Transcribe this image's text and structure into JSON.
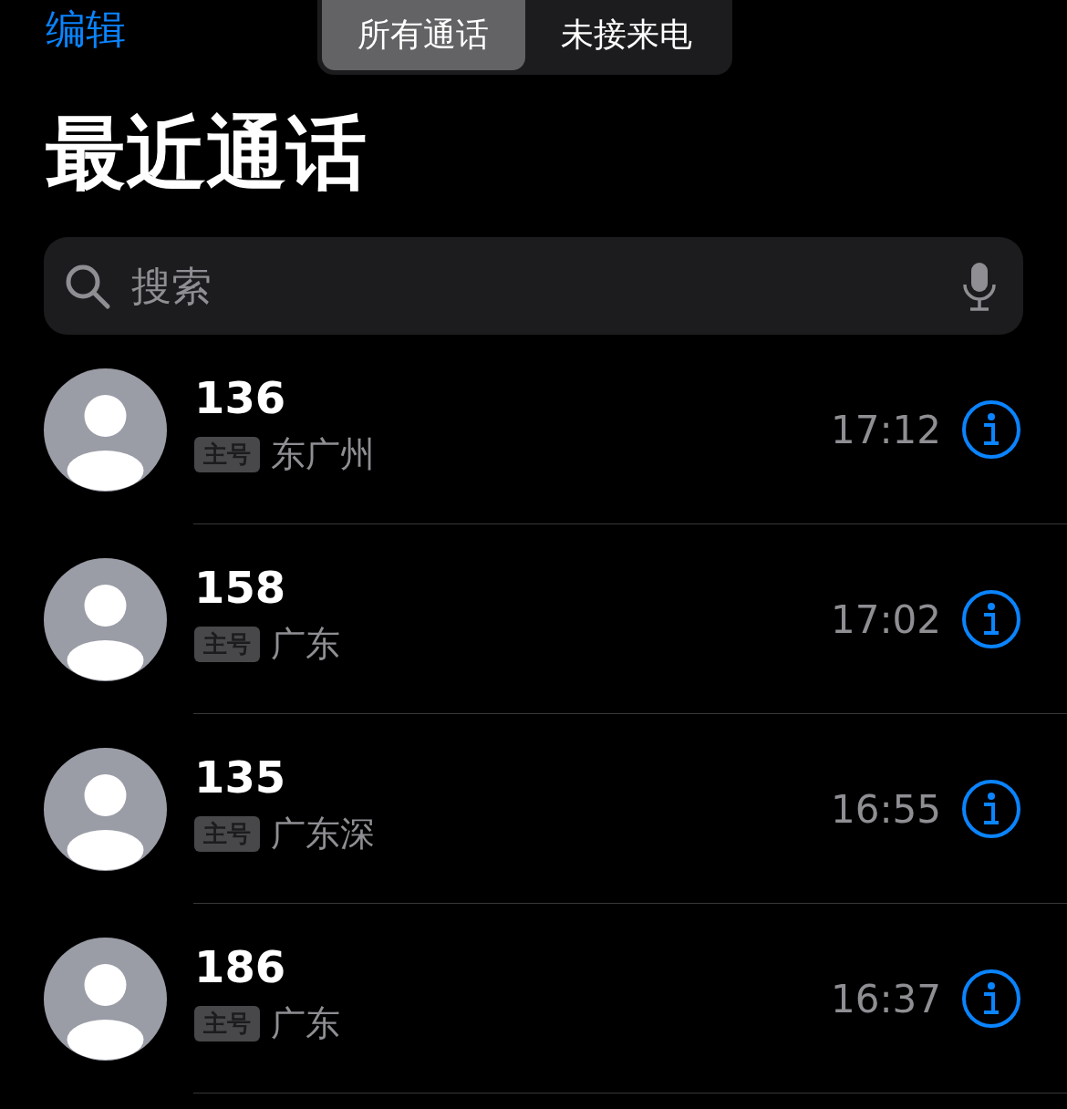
{
  "nav": {
    "edit": "编辑",
    "segments": [
      {
        "label": "所有通话",
        "selected": true
      },
      {
        "label": "未接来电",
        "selected": false
      }
    ]
  },
  "title": "最近通话",
  "search": {
    "placeholder": "搜索"
  },
  "calls": [
    {
      "number": "136",
      "tag": "主号",
      "location": "东广州",
      "time": "17:12"
    },
    {
      "number": "158",
      "tag": "主号",
      "location": "广东",
      "time": "17:02"
    },
    {
      "number": "135",
      "tag": "主号",
      "location": "广东深",
      "time": "16:55"
    },
    {
      "number": "186",
      "tag": "主号",
      "location": "广东",
      "time": "16:37"
    }
  ]
}
